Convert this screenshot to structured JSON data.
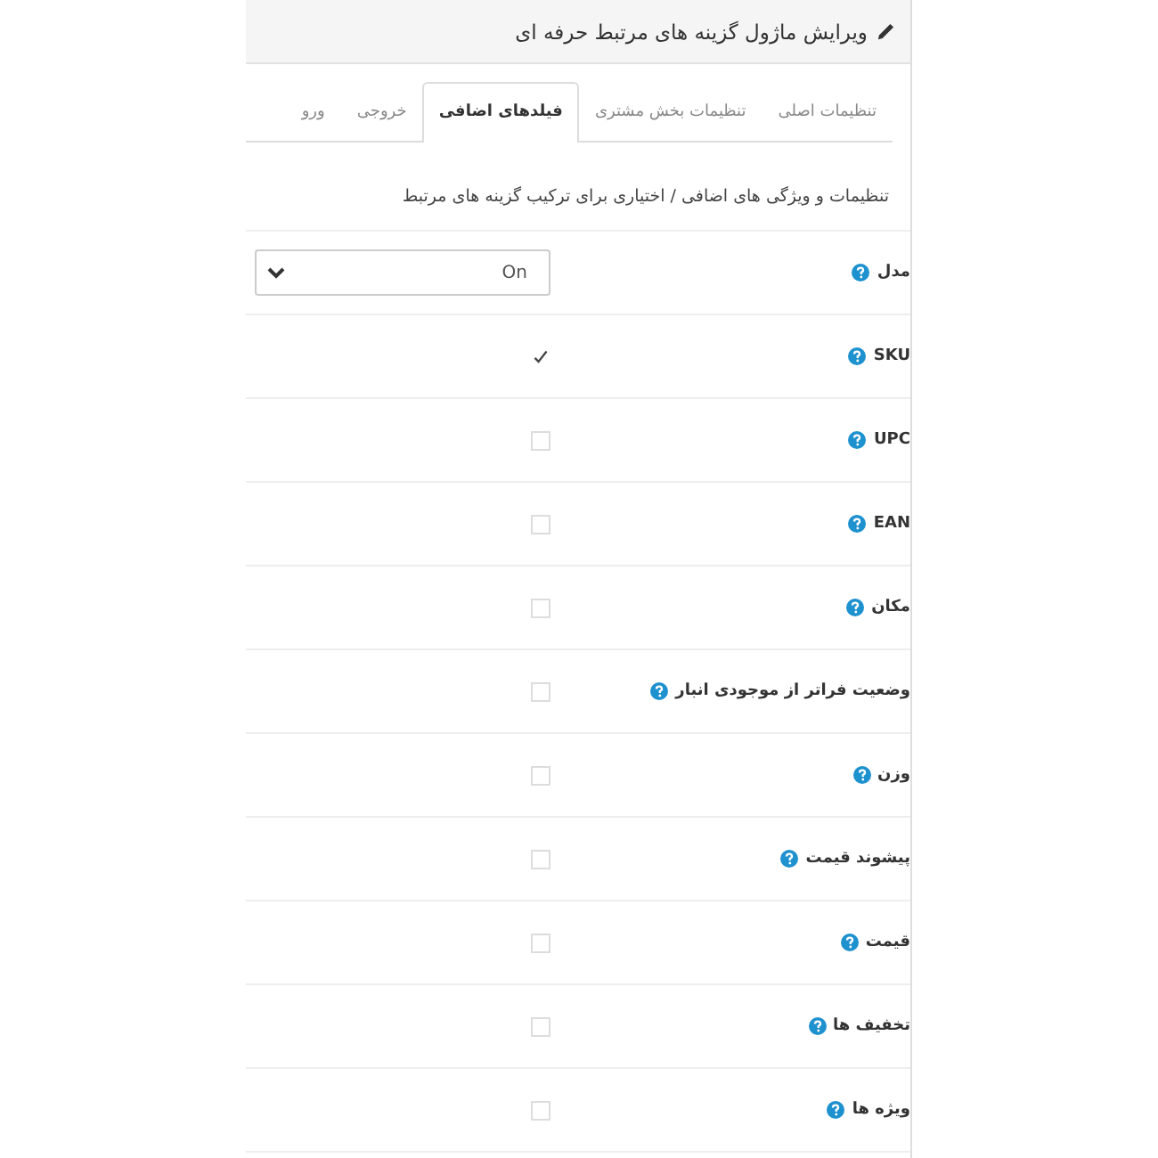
{
  "header": {
    "title": "ویرایش ماژول گزینه های مرتبط حرفه ای"
  },
  "tabs": [
    {
      "label": "تنظیمات اصلی",
      "selected": false
    },
    {
      "label": "تنظیمات بخش مشتری",
      "selected": false
    },
    {
      "label": "فیلدهای اضافی",
      "selected": true
    },
    {
      "label": "خروجی",
      "selected": false
    },
    {
      "label": "ورو",
      "selected": false
    }
  ],
  "description": "تنظیمات و ویژگی های اضافی / اختیاری برای ترکیب گزینه های مرتبط",
  "rows": [
    {
      "kind": "select",
      "label": "مدل",
      "value": "On"
    },
    {
      "kind": "checkbox",
      "label": "SKU",
      "checked": true
    },
    {
      "kind": "checkbox",
      "label": "UPC",
      "checked": false
    },
    {
      "kind": "checkbox",
      "label": "EAN",
      "checked": false
    },
    {
      "kind": "checkbox",
      "label": "مکان",
      "checked": false
    },
    {
      "kind": "checkbox",
      "label": "وضعیت فراتر از موجودی انبار",
      "checked": false
    },
    {
      "kind": "checkbox",
      "label": "وزن",
      "checked": false
    },
    {
      "kind": "checkbox",
      "label": "پیشوند قیمت",
      "checked": false
    },
    {
      "kind": "checkbox",
      "label": "قیمت",
      "checked": false
    },
    {
      "kind": "checkbox",
      "label": "تخفیف ها",
      "checked": false
    },
    {
      "kind": "checkbox",
      "label": "ویژه ها",
      "checked": false
    }
  ]
}
